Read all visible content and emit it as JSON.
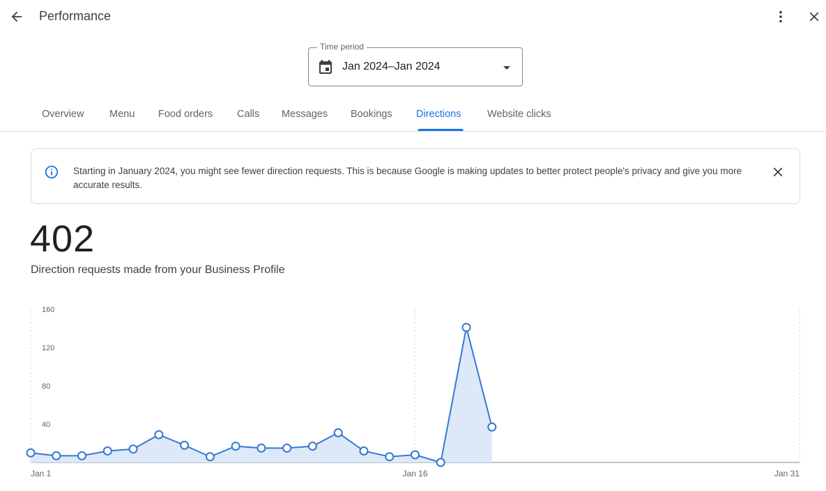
{
  "header": {
    "title": "Performance",
    "icons": {
      "back": "arrow-back-icon",
      "more": "more-vert-icon",
      "close": "close-icon"
    }
  },
  "time_period": {
    "label": "Time period",
    "value": "Jan 2024–Jan 2024",
    "icon": "calendar-icon"
  },
  "tabs": [
    {
      "label": "Overview",
      "active": false
    },
    {
      "label": "Menu",
      "active": false
    },
    {
      "label": "Food orders",
      "active": false
    },
    {
      "label": "Calls",
      "active": false
    },
    {
      "label": "Messages",
      "active": false
    },
    {
      "label": "Bookings",
      "active": false
    },
    {
      "label": "Directions",
      "active": true
    },
    {
      "label": "Website clicks",
      "active": false
    }
  ],
  "notice": {
    "text": "Starting in January 2024, you might see fewer direction requests. This is because Google is making updates to better protect people's privacy and give you more accurate results.",
    "icon": "info-icon"
  },
  "metric": {
    "value": "402",
    "description": "Direction requests made from your Business Profile"
  },
  "colors": {
    "accent": "#1a73e8",
    "line": "#3478d4",
    "area": "#dde8f8"
  },
  "chart_data": {
    "type": "area",
    "x": [
      1,
      2,
      3,
      4,
      5,
      6,
      7,
      8,
      9,
      10,
      11,
      12,
      13,
      14,
      15,
      16,
      17,
      18,
      19
    ],
    "series": [
      {
        "values": [
          10,
          7,
          7,
          12,
          14,
          29,
          18,
          6,
          17,
          15,
          15,
          17,
          31,
          12,
          6,
          8,
          0,
          141,
          37
        ]
      }
    ],
    "xlim": [
      1,
      31
    ],
    "ylim": [
      0,
      160
    ],
    "yticks": [
      40,
      80,
      120,
      160
    ],
    "xticks": [
      {
        "day": 1,
        "label": "Jan 1"
      },
      {
        "day": 16,
        "label": "Jan 16"
      },
      {
        "day": 31,
        "label": "Jan 31"
      }
    ],
    "grid": "vertical-dashed"
  }
}
